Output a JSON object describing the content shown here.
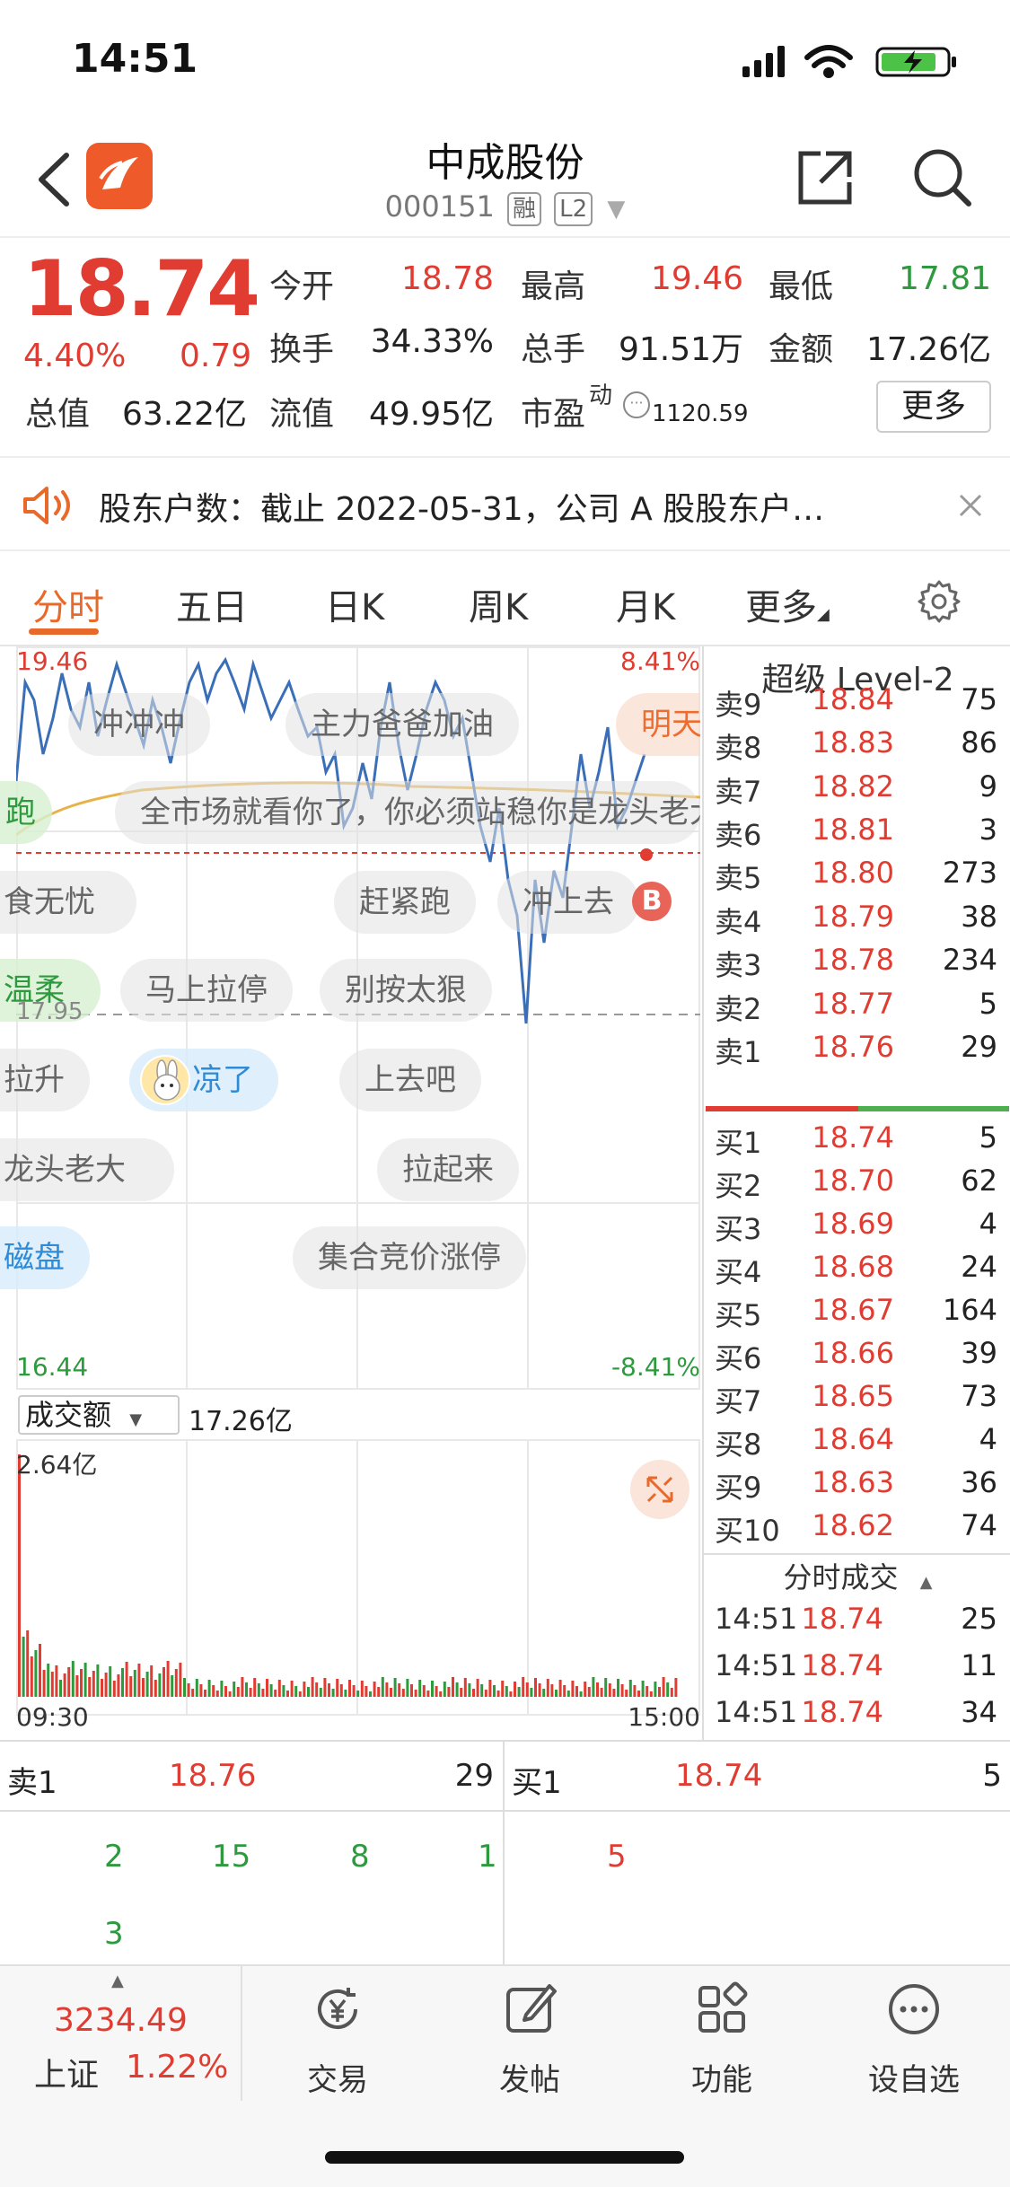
{
  "status": {
    "time": "14:51"
  },
  "header": {
    "title": "中成股份",
    "code": "000151",
    "tag_margin": "融",
    "tag_level": "L2"
  },
  "quote": {
    "price": "18.74",
    "change_pct": "4.40%",
    "change_abs": "0.79",
    "open_label": "今开",
    "open": "18.78",
    "high_label": "最高",
    "high": "19.46",
    "low_label": "最低",
    "low": "17.81",
    "turnover_label": "换手",
    "turnover": "34.33%",
    "volume_label": "总手",
    "volume": "91.51万",
    "amount_label": "金额",
    "amount": "17.26亿",
    "mktcap_label": "总值",
    "mktcap": "63.22亿",
    "float_label": "流值",
    "float": "49.95亿",
    "pe_label": "市盈",
    "pe_sup": "动",
    "pe": "1120.59",
    "more_label": "更多"
  },
  "notice": {
    "text": "股东户数：截止 2022-05-31，公司 A 股股东户…"
  },
  "tabs": [
    "分时",
    "五日",
    "日K",
    "周K",
    "月K",
    "更多"
  ],
  "chart": {
    "max_price": "19.46",
    "min_price": "16.44",
    "max_pct": "8.41%",
    "min_pct": "-8.41%",
    "mid_price": "17.95",
    "volume_selector": "成交额",
    "volume_total": "17.26亿",
    "volume_max": "2.64亿",
    "time_start": "09:30",
    "time_end": "15:00",
    "marker": "B"
  },
  "danmaku": [
    "冲冲冲",
    "主力爸爸加油",
    "明天",
    "全市场就看你了，你必须站稳你是龙头老大",
    "跑",
    "食无忧",
    "赶紧跑",
    "冲上去",
    "温柔",
    "马上拉停",
    "别按太狠",
    "拉升",
    "凉了",
    "上去吧",
    "龙头老大",
    "拉起来",
    "磁盘",
    "集合竞价涨停"
  ],
  "orderbook": {
    "title": "超级 Level-2",
    "asks": [
      {
        "label": "卖9",
        "price": "18.84",
        "vol": "75"
      },
      {
        "label": "卖8",
        "price": "18.83",
        "vol": "86"
      },
      {
        "label": "卖7",
        "price": "18.82",
        "vol": "9"
      },
      {
        "label": "卖6",
        "price": "18.81",
        "vol": "3"
      },
      {
        "label": "卖5",
        "price": "18.80",
        "vol": "273"
      },
      {
        "label": "卖4",
        "price": "18.79",
        "vol": "38"
      },
      {
        "label": "卖3",
        "price": "18.78",
        "vol": "234"
      },
      {
        "label": "卖2",
        "price": "18.77",
        "vol": "5"
      },
      {
        "label": "卖1",
        "price": "18.76",
        "vol": "29"
      }
    ],
    "bids": [
      {
        "label": "买1",
        "price": "18.74",
        "vol": "5"
      },
      {
        "label": "买2",
        "price": "18.70",
        "vol": "62"
      },
      {
        "label": "买3",
        "price": "18.69",
        "vol": "4"
      },
      {
        "label": "买4",
        "price": "18.68",
        "vol": "24"
      },
      {
        "label": "买5",
        "price": "18.67",
        "vol": "164"
      },
      {
        "label": "买6",
        "price": "18.66",
        "vol": "39"
      },
      {
        "label": "买7",
        "price": "18.65",
        "vol": "73"
      },
      {
        "label": "买8",
        "price": "18.64",
        "vol": "4"
      },
      {
        "label": "买9",
        "price": "18.63",
        "vol": "36"
      },
      {
        "label": "买10",
        "price": "18.62",
        "vol": "74"
      }
    ],
    "trades_title": "分时成交",
    "trades": [
      {
        "time": "14:51",
        "price": "18.74",
        "vol": "25"
      },
      {
        "time": "14:51",
        "price": "18.74",
        "vol": "11"
      },
      {
        "time": "14:51",
        "price": "18.74",
        "vol": "34"
      }
    ]
  },
  "best": {
    "ask_label": "卖1",
    "ask_price": "18.76",
    "ask_vol": "29",
    "bid_label": "买1",
    "bid_price": "18.74",
    "bid_vol": "5",
    "ask_ticks": [
      "2",
      "15",
      "8",
      "1",
      "3"
    ],
    "bid_ticks": [
      "5"
    ]
  },
  "nav": {
    "index_value": "3234.49",
    "index_name": "上证",
    "index_pct": "1.22%",
    "trade": "交易",
    "post": "发帖",
    "functions": "功能",
    "watchlist": "设自选"
  },
  "colors": {
    "up": "#e03c31",
    "down": "#2e9a3e",
    "accent": "#e86a2b",
    "line": "#3a6fb8",
    "avg": "#e8b24a"
  }
}
